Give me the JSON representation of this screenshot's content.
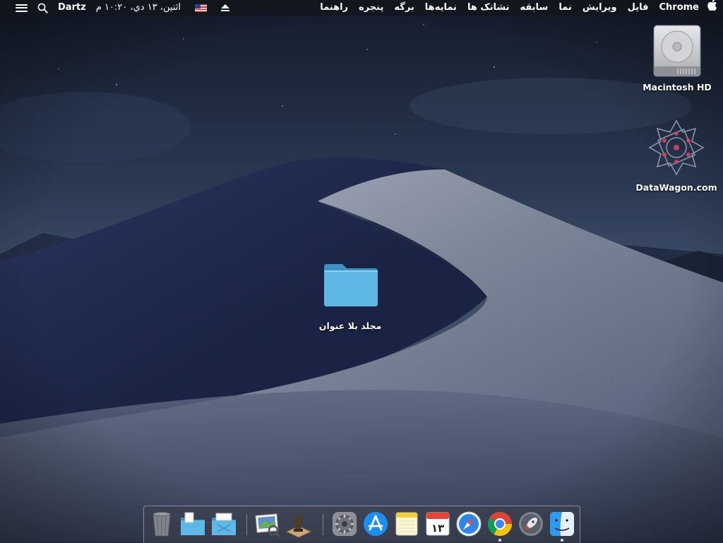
{
  "menubar": {
    "apple_icon": "apple-icon",
    "app_name": "Chrome",
    "menus": [
      "فایل",
      "ویرایش",
      "نما",
      "سابقه",
      "نشانک ها",
      "نمایه‌ها",
      "برگه",
      "پنجره",
      "راهنما"
    ],
    "status": {
      "clock": "اثنين، ۱۳ دي، ۱۰:۲۰ م",
      "user": "Dartz",
      "search_icon": "search-icon",
      "control_icon": "list-icon",
      "input_flag": "us-flag-icon",
      "eject_icon": "eject-icon"
    }
  },
  "desktop": {
    "icons": [
      {
        "label": "Macintosh HD",
        "icon": "hard-drive-icon"
      },
      {
        "label": "DataWagon.com",
        "icon": "star-emblem-icon"
      },
      {
        "label": "مجلد بلا عنوان",
        "icon": "folder-icon"
      }
    ]
  },
  "dock": {
    "calendar_day": "۱۳",
    "items": [
      {
        "icon": "finder-icon",
        "running": true
      },
      {
        "icon": "launchpad-icon",
        "running": false
      },
      {
        "icon": "chrome-icon",
        "running": true
      },
      {
        "icon": "safari-icon",
        "running": false
      },
      {
        "icon": "calendar-icon",
        "running": false
      },
      {
        "icon": "notes-icon",
        "running": false
      },
      {
        "icon": "app-store-icon",
        "running": false
      },
      {
        "icon": "system-preferences-icon",
        "running": false
      },
      {
        "icon": "chess-icon",
        "running": false
      },
      {
        "icon": "preview-icon",
        "running": false
      },
      {
        "icon": "applications-folder-icon",
        "running": false
      },
      {
        "icon": "documents-folder-icon",
        "running": false
      },
      {
        "icon": "downloads-folder-icon",
        "running": false
      },
      {
        "icon": "trash-icon",
        "running": false
      }
    ]
  },
  "colors": {
    "folder_blue": "#5fb7e5",
    "sky_top": "#1c2538",
    "dune_dark": "#1d2747",
    "dune_light": "#8c94a6"
  }
}
